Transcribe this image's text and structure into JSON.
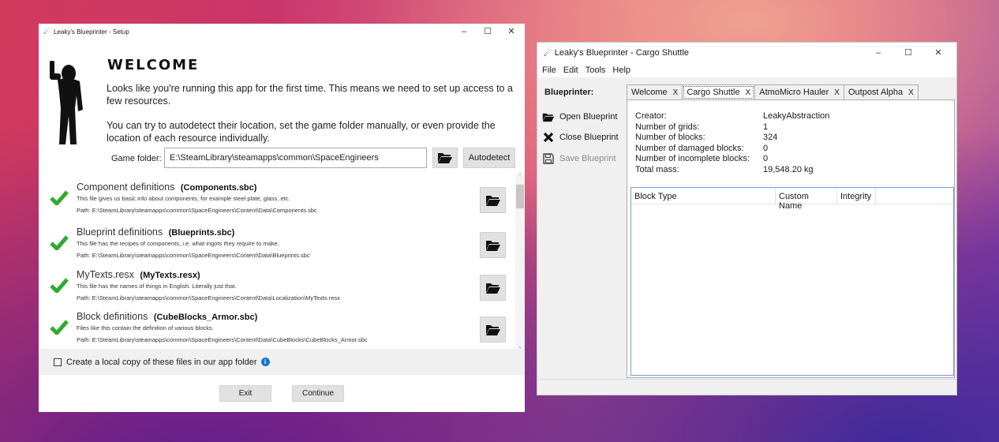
{
  "setup": {
    "title": "Leaky's Blueprinter - Setup",
    "window_controls": {
      "minimize": "–",
      "maximize": "☐",
      "close": "✕"
    },
    "heading": "WELCOME",
    "intro_1": "Looks like you're running this app for the first time. This means we need to set up access to a few resources.",
    "intro_2": "You can try to autodetect their location, set the game folder manually, or even provide the location of each resource individually.",
    "game_folder_label": "Game folder:",
    "game_folder_value": "E:\\SteamLibrary\\steamapps\\common\\SpaceEngineers",
    "autodetect_label": "Autodetect",
    "resources": [
      {
        "name": "Component definitions",
        "file": "(Components.sbc)",
        "desc": "This file gives us basic info about components, for example steel plate, glass, etc.",
        "path": "Path:  E:\\SteamLibrary\\steamapps\\common\\SpaceEngineers\\Content\\Data\\Components.sbc"
      },
      {
        "name": "Blueprint definitions",
        "file": "(Blueprints.sbc)",
        "desc": "This file has the recipes of components, i.e. what ingots they require to make.",
        "path": "Path:  E:\\SteamLibrary\\steamapps\\common\\SpaceEngineers\\Content\\Data\\Blueprints.sbc"
      },
      {
        "name": "MyTexts.resx",
        "file": "(MyTexts.resx)",
        "desc": "This file has the names of things in English. Literally just that.",
        "path": "Path:  E:\\SteamLibrary\\steamapps\\common\\SpaceEngineers\\Content\\Data\\Localization\\MyTexts.resx"
      },
      {
        "name": "Block definitions",
        "file": "(CubeBlocks_Armor.sbc)",
        "desc": "Files like this contain the definition of various blocks.",
        "path": "Path:  E:\\SteamLibrary\\steamapps\\common\\SpaceEngineers\\Content\\Data\\CubeBlocks\\CubeBlocks_Armor.sbc"
      }
    ],
    "local_copy_label": "Create a local copy of these files in our app folder",
    "local_copy_checked": false,
    "exit_label": "Exit",
    "continue_label": "Continue"
  },
  "blueprinter": {
    "title": "Leaky's Blueprinter - Cargo Shuttle",
    "window_controls": {
      "minimize": "–",
      "maximize": "☐",
      "close": "✕"
    },
    "menu": [
      "File",
      "Edit",
      "Tools",
      "Help"
    ],
    "sidebar_title": "Blueprinter:",
    "sidebar_buttons": [
      {
        "label": "Open Blueprint",
        "icon": "folder-open-icon",
        "enabled": true
      },
      {
        "label": "Close Blueprint",
        "icon": "close-x-icon",
        "enabled": true
      },
      {
        "label": "Save Blueprint",
        "icon": "floppy-disk-icon",
        "enabled": false
      }
    ],
    "tabs": [
      {
        "label": "Welcome",
        "close": "X",
        "active": false
      },
      {
        "label": "Cargo Shuttle",
        "close": "X",
        "active": true
      },
      {
        "label": "AtmoMicro Hauler",
        "close": "X",
        "active": false
      },
      {
        "label": "Outpost Alpha",
        "close": "X",
        "active": false
      }
    ],
    "properties": [
      {
        "key": "Creator:",
        "value": "LeakyAbstraction"
      },
      {
        "key": "Number of grids:",
        "value": "1"
      },
      {
        "key": "Number of blocks:",
        "value": "324"
      },
      {
        "key": "Number of damaged blocks:",
        "value": "0"
      },
      {
        "key": "Number of incomplete blocks:",
        "value": "0"
      },
      {
        "key": "Total mass:",
        "value": "19,548.20 kg"
      }
    ],
    "grid_columns": [
      "Block Type",
      "Custom Name",
      "Integrity"
    ]
  }
}
